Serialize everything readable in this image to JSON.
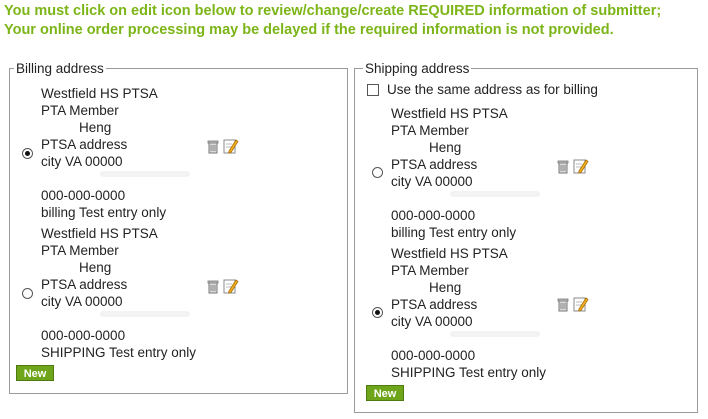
{
  "warning": "You must click on edit icon below to review/change/create REQUIRED information of submitter; Your online order processing may be delayed if the required information is not provided.",
  "billing": {
    "legend": "Billing address",
    "addresses": [
      {
        "line1": "Westfield HS PTSA",
        "line2": "PTA Member",
        "line3": "Heng",
        "line4": "PTSA address",
        "line5": "city VA 00000",
        "line6": "000-000-0000",
        "line7": "billing Test entry only",
        "selected": true
      },
      {
        "line1": "Westfield HS PTSA",
        "line2": "PTA Member",
        "line3": "Heng",
        "line4": "PTSA address",
        "line5": "city VA 00000",
        "line6": "000-000-0000",
        "line7": "SHIPPING Test entry only",
        "selected": false
      }
    ],
    "new_label": "New"
  },
  "shipping": {
    "legend": "Shipping address",
    "same_as_billing_label": "Use the same address as for billing",
    "addresses": [
      {
        "line1": "Westfield HS PTSA",
        "line2": "PTA Member",
        "line3": "Heng",
        "line4": "PTSA address",
        "line5": "city VA 00000",
        "line6": "000-000-0000",
        "line7": "billing Test entry only",
        "selected": false
      },
      {
        "line1": "Westfield HS PTSA",
        "line2": "PTA Member",
        "line3": "Heng",
        "line4": "PTSA address",
        "line5": "city VA 00000",
        "line6": "000-000-0000",
        "line7": "SHIPPING Test entry only",
        "selected": true
      }
    ],
    "new_label": "New"
  },
  "icons": {
    "delete": "trash-icon",
    "edit": "edit-pencil-icon"
  },
  "colors": {
    "warning": "#7cb518",
    "button": "#6ea51a"
  }
}
